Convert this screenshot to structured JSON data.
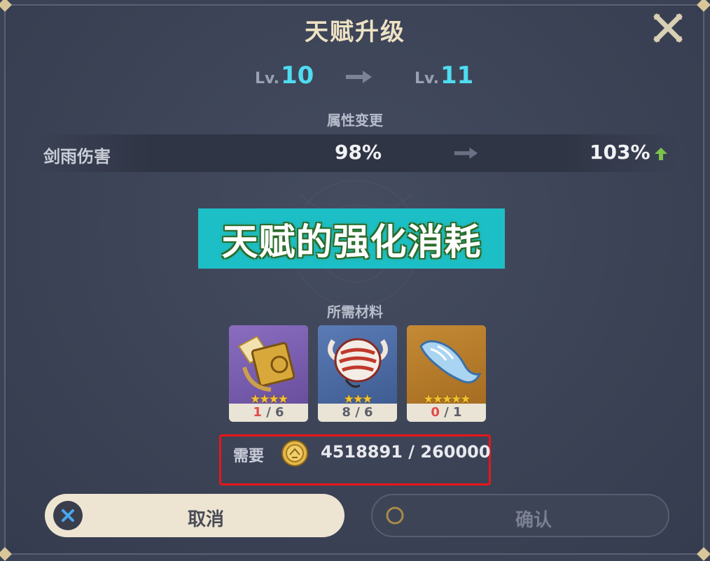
{
  "dialog": {
    "title": "天赋升级"
  },
  "levels": {
    "prefix": "Lv.",
    "current": "10",
    "next": "11"
  },
  "attributes": {
    "section_label": "属性变更",
    "rows": [
      {
        "name": "剑雨伤害",
        "old_value": "98%",
        "new_value": "103%"
      }
    ]
  },
  "banner": {
    "text": "天赋的强化消耗"
  },
  "materials": {
    "section_label": "所需材料",
    "items": [
      {
        "icon": "talent-book-icon",
        "stars": "★★★★",
        "have": "1",
        "need": "6",
        "insufficient": true,
        "bg": "#7a5fb0"
      },
      {
        "icon": "mask-icon",
        "stars": "★★★",
        "have": "8",
        "need": "6",
        "insufficient": false,
        "bg": "#4a6aa0"
      },
      {
        "icon": "fish-fin-icon",
        "stars": "★★★★★",
        "have": "0",
        "need": "1",
        "insufficient": true,
        "bg": "#b57a2c"
      }
    ]
  },
  "requirement": {
    "label": "需要",
    "icon": "mora-coin-icon",
    "value": "4518891 / 260000"
  },
  "buttons": {
    "cancel": {
      "label": "取消",
      "icon": "close-x-icon"
    },
    "confirm": {
      "label": "确认",
      "icon": "circle-icon"
    }
  },
  "colors": {
    "panel_bg": "#3b4255",
    "level_accent": "#4fdcf0",
    "banner_bg": "#1dbfc6",
    "highlight_border": "#e8161a",
    "insufficient": "#e24a46",
    "up_arrow": "#7cc34a"
  }
}
